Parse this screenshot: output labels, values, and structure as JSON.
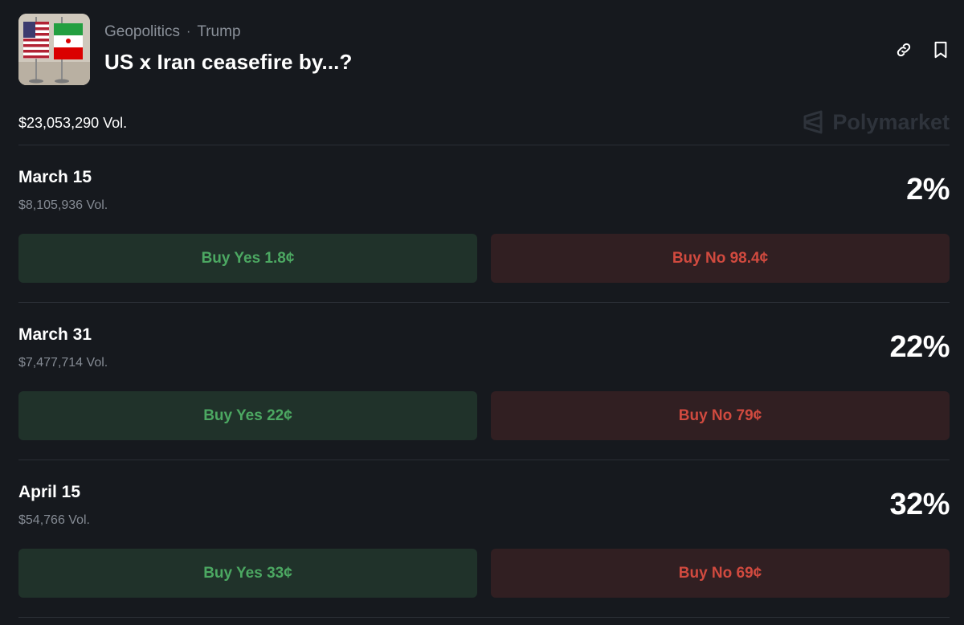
{
  "header": {
    "category": "Geopolitics",
    "separator": "·",
    "subcategory": "Trump",
    "title": "US x Iran ceasefire by...?",
    "icons": [
      "link-icon",
      "bookmark-icon"
    ]
  },
  "summary": {
    "total_volume": "$23,053,290 Vol.",
    "brand": "Polymarket"
  },
  "colors": {
    "background": "#16191e",
    "yes_bg": "#20322a",
    "yes_text": "#4ca862",
    "no_bg": "#311f22",
    "no_text": "#d14a3f"
  },
  "markets": [
    {
      "name": "March 15",
      "volume": "$8,105,936 Vol.",
      "chance": "2%",
      "buy_yes": "Buy Yes 1.8¢",
      "buy_no": "Buy No 98.4¢"
    },
    {
      "name": "March 31",
      "volume": "$7,477,714 Vol.",
      "chance": "22%",
      "buy_yes": "Buy Yes 22¢",
      "buy_no": "Buy No 79¢"
    },
    {
      "name": "April 15",
      "volume": "$54,766 Vol.",
      "chance": "32%",
      "buy_yes": "Buy Yes 33¢",
      "buy_no": "Buy No 69¢"
    }
  ]
}
